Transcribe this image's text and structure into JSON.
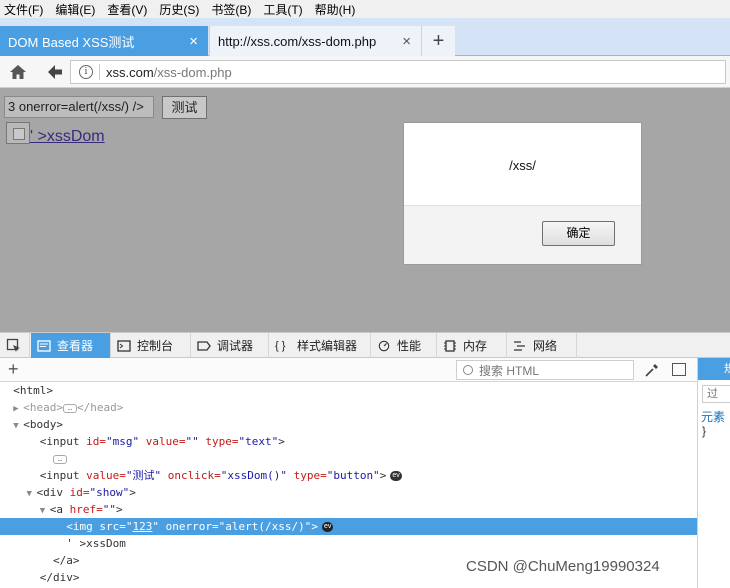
{
  "menu": [
    "文件(F)",
    "编辑(E)",
    "查看(V)",
    "历史(S)",
    "书签(B)",
    "工具(T)",
    "帮助(H)"
  ],
  "tabs": [
    {
      "title": "DOM Based XSS测试",
      "active": true
    },
    {
      "title": "http://xss.com/xss-dom.php",
      "active": false
    }
  ],
  "tab_close": "×",
  "new_tab": "+",
  "address": {
    "host": "xss.com",
    "path": "/xss-dom.php"
  },
  "page": {
    "input_value": "3 onerror=alert(/xss/) />",
    "button_label": "测试",
    "link_text": "' >xssDom"
  },
  "dialog": {
    "message": "/xss/",
    "ok_label": "确定"
  },
  "devtools": {
    "tabs": [
      "查看器",
      "控制台",
      "调试器",
      "样式编辑器",
      "性能",
      "内存",
      "网络"
    ],
    "search_placeholder": "搜索 HTML",
    "side_filter": "过",
    "side_element": "元素",
    "side_brace": "}",
    "side_tab": "規"
  },
  "tree": {
    "html": "<html>",
    "head_open": "<head>",
    "head_close": "</head>",
    "body": "<body>",
    "input1_tag": "<input",
    "input1_id_name": " id=",
    "input1_id_val": "\"msg\"",
    "input1_value_name": " value=",
    "input1_value_val": "\"\"",
    "input1_type_name": " type=",
    "input1_type_val": "\"text\"",
    "input1_end": ">",
    "input2_tag": "<input",
    "input2_value_name": " value=",
    "input2_value_val": "\"测试\"",
    "input2_onclick_name": " onclick=",
    "input2_onclick_val": "\"xssDom()\"",
    "input2_type_name": " type=",
    "input2_type_val": "\"button\"",
    "input2_end": ">",
    "div_tag": "<div",
    "div_id_name": " id=",
    "div_id_val": "\"show\"",
    "div_end": ">",
    "a_tag": "<a",
    "a_href_name": " href=",
    "a_href_val": "\"\"",
    "a_end": ">",
    "img_tag": "<img",
    "img_src_name": " src=",
    "img_src_q1": "\"",
    "img_src_val": "123",
    "img_src_q2": "\"",
    "img_onerror_name": " onerror=",
    "img_onerror_val": "\"alert(/xss/)\"",
    "img_end": ">",
    "text_node": "' >xssDom",
    "a_close": "</a>",
    "div_close": "</div>",
    "ev": "ev"
  },
  "watermark": "CSDN @ChuMeng19990324"
}
